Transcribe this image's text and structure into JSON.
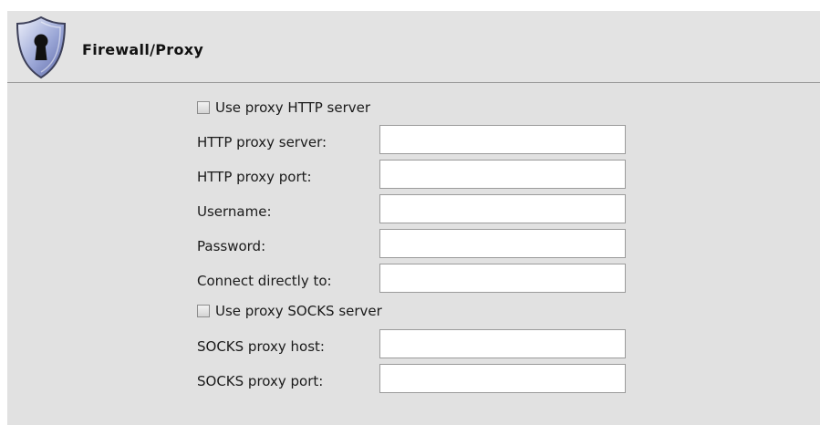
{
  "header": {
    "title": "Firewall/Proxy",
    "icon": "keyhole-shield-icon"
  },
  "http": {
    "use_label": "Use proxy HTTP server",
    "use_checked": false,
    "server_label": "HTTP proxy server:",
    "server_value": "",
    "port_label": "HTTP proxy port:",
    "port_value": "",
    "username_label": "Username:",
    "username_value": "",
    "password_label": "Password:",
    "password_value": "",
    "direct_label": "Connect directly to:",
    "direct_value": ""
  },
  "socks": {
    "use_label": "Use proxy SOCKS server",
    "use_checked": false,
    "host_label": "SOCKS proxy host:",
    "host_value": "",
    "port_label": "SOCKS proxy port:",
    "port_value": ""
  }
}
